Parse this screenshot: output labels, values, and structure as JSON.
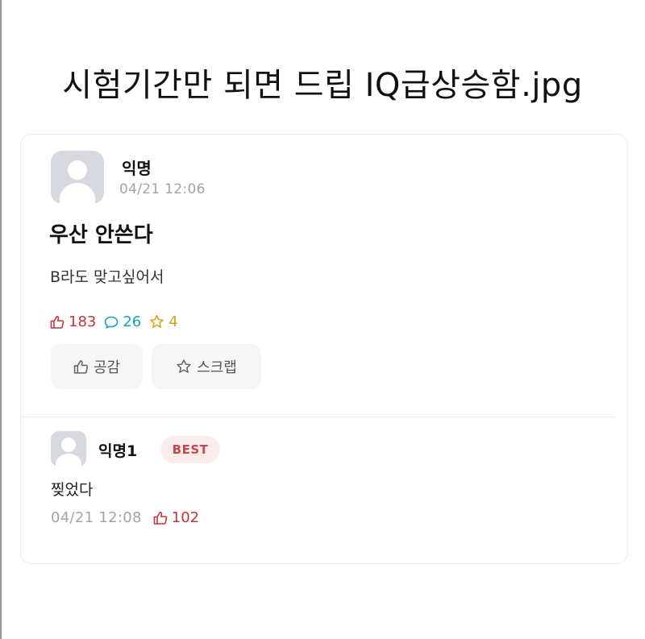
{
  "headline": "시험기간만 되면 드립 IQ급상승함.jpg",
  "post": {
    "author": "익명",
    "timestamp": "04/21 12:06",
    "title": "우산 안쓴다",
    "body": "B라도 맞고싶어서",
    "stats": {
      "likes": "183",
      "comments": "26",
      "scraps": "4"
    },
    "buttons": {
      "like_label": "공감",
      "scrap_label": "스크랩"
    },
    "avatar_icon": "default-profile-icon"
  },
  "comment": {
    "author": "익명1",
    "badge": "BEST",
    "body": "찢었다",
    "timestamp": "04/21 12:08",
    "likes": "102",
    "avatar_icon": "default-profile-icon"
  },
  "colors": {
    "like": "#c6343a",
    "comment": "#14a3b8",
    "scrap": "#d3a51a",
    "best_badge_bg": "#fbecec",
    "best_badge_text": "#c44a4a"
  }
}
